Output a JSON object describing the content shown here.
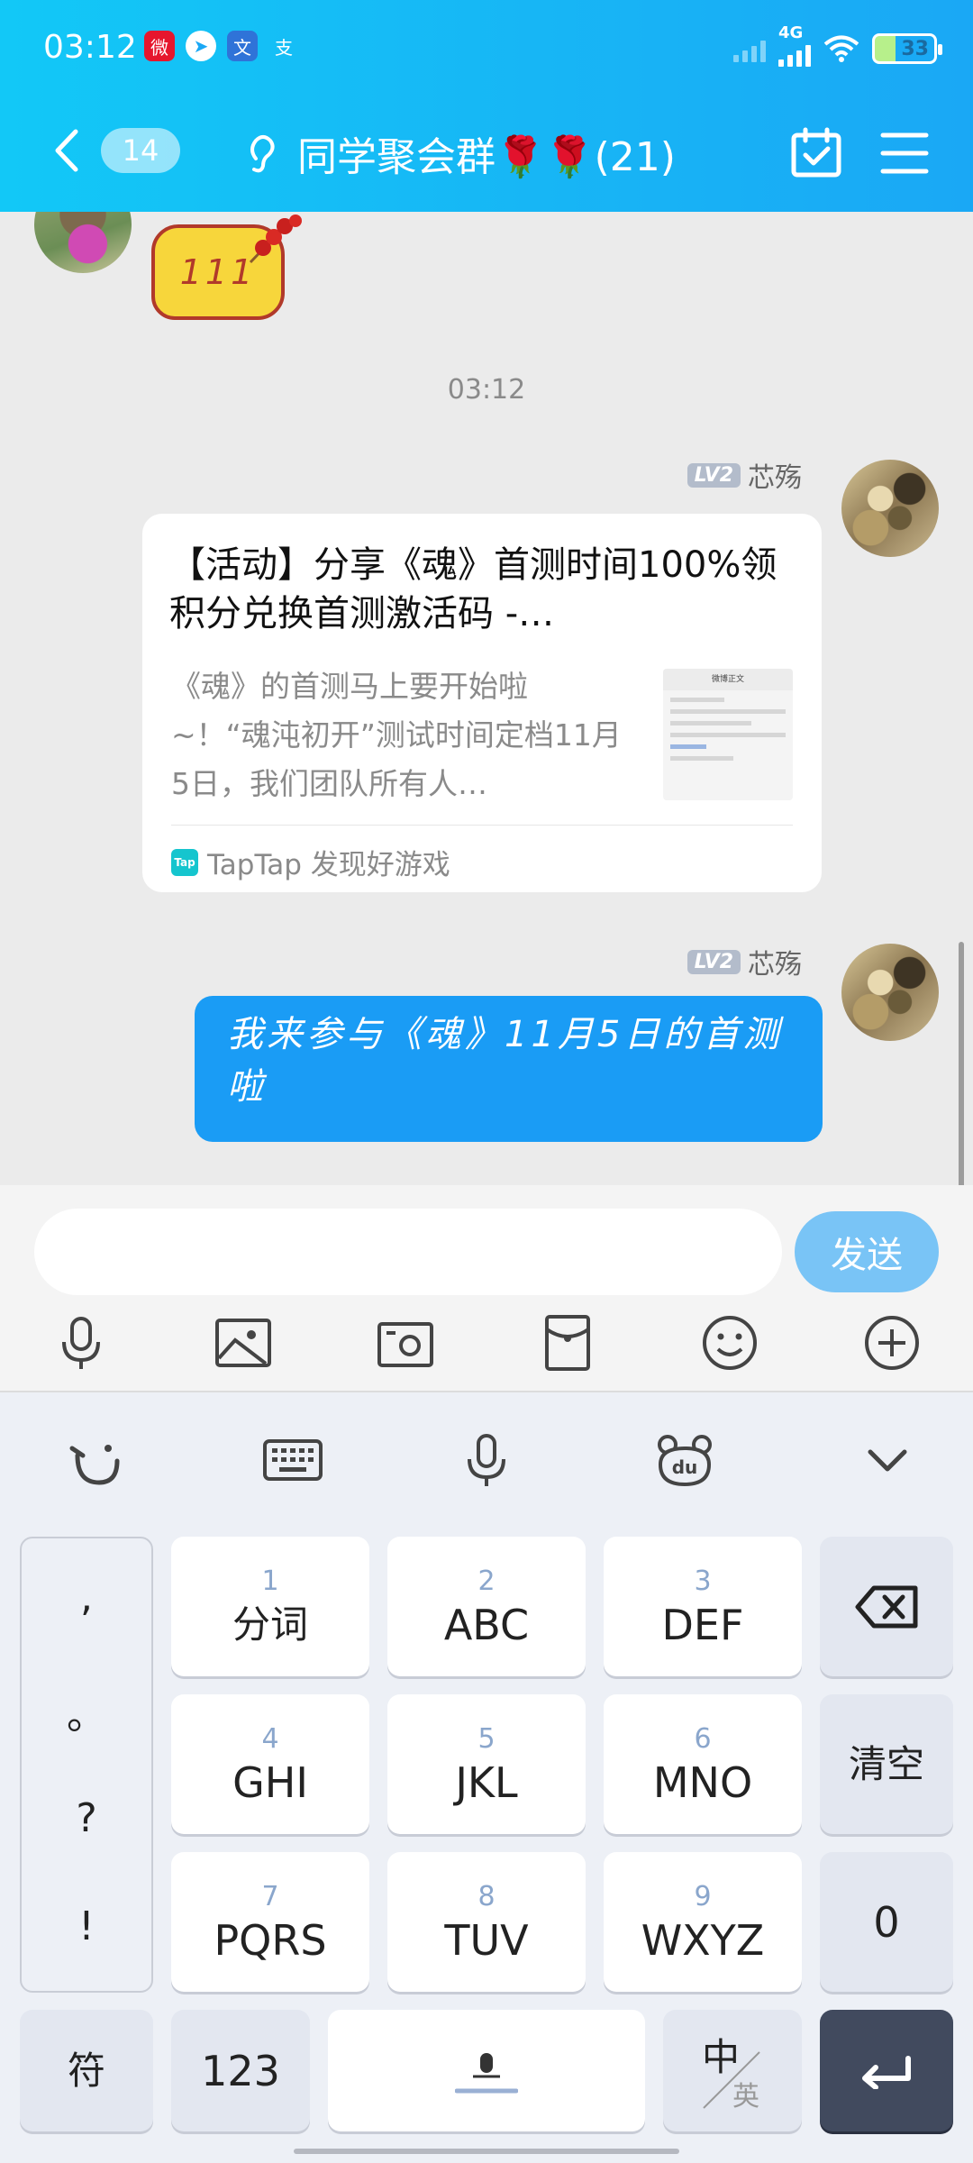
{
  "status_bar": {
    "time": "03:12",
    "network": "4G",
    "battery": "33"
  },
  "header": {
    "unread_count": "14",
    "title": "同学聚会群🌹🌹(21)"
  },
  "chat": {
    "sticker_text": "111",
    "timestamp": "03:12",
    "messages": [
      {
        "sender_level": "LV2",
        "sender_name": "芯殇",
        "type": "share_card",
        "card_title": "【活动】分享《魂》首测时间100%领积分兑换首测激活码 -…",
        "card_desc": "《魂》的首测马上要开始啦~！“魂沌初开”测试时间定档11月5日，我们团队所有人…",
        "thumbnail_header": "微博正文",
        "source_icon": "Tap",
        "source": "TapTap 发现好游戏"
      },
      {
        "sender_level": "LV2",
        "sender_name": "芯殇",
        "type": "text",
        "text": "我来参与《魂》11月5日的首测啦"
      }
    ]
  },
  "composer": {
    "input_value": "",
    "send_label": "发送"
  },
  "keyboard": {
    "punctuation": [
      ",",
      "。",
      "?",
      "!"
    ],
    "keys": [
      {
        "num": "1",
        "label": "分词"
      },
      {
        "num": "2",
        "label": "ABC"
      },
      {
        "num": "3",
        "label": "DEF"
      },
      {
        "num": "4",
        "label": "GHI"
      },
      {
        "num": "5",
        "label": "JKL"
      },
      {
        "num": "6",
        "label": "MNO"
      },
      {
        "num": "7",
        "label": "PQRS"
      },
      {
        "num": "8",
        "label": "TUV"
      },
      {
        "num": "9",
        "label": "WXYZ"
      }
    ],
    "clear_label": "清空",
    "zero_label": "0",
    "symbol_label": "符",
    "numeric_label": "123",
    "lang_primary": "中",
    "lang_secondary": "英"
  },
  "colors": {
    "header_start": "#12c8f7",
    "header_end": "#1aa8f5",
    "bubble": "#1a9cf5",
    "send_button": "#79c4f6",
    "enter_key": "#414a5e"
  }
}
